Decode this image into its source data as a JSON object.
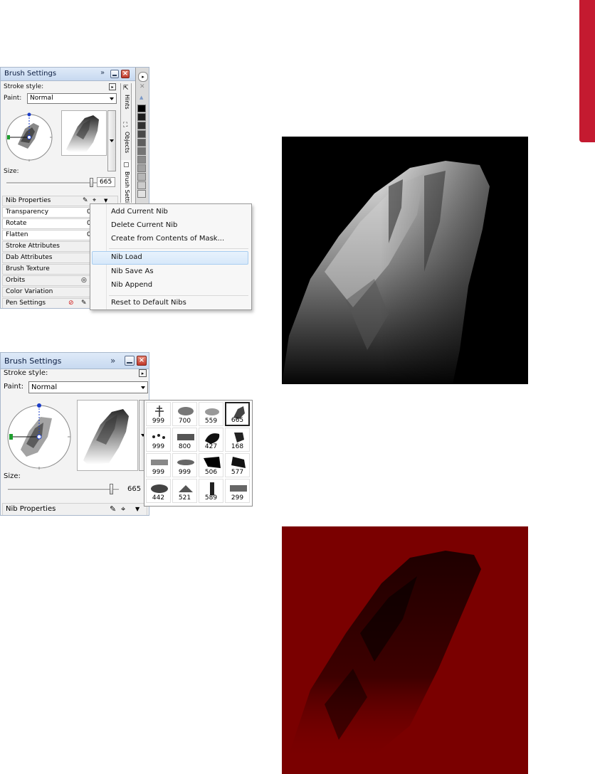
{
  "colors": {
    "accent_tab": "#c41a30",
    "photo_red_bg": "#7a0000",
    "photo_dark_bg": "#000000"
  },
  "panel1": {
    "title": "Brush Settings",
    "stroke_style_label": "Stroke style:",
    "paint_label": "Paint:",
    "paint_value": "Normal",
    "size_label": "Size:",
    "size_value": "665",
    "size_fraction": 0.93,
    "side_tabs": [
      "Hints",
      "Objects",
      "Brush Setti"
    ],
    "sections": {
      "nib_properties": "Nib Properties",
      "transparency": "Transparency",
      "rotate": "Rotate",
      "flatten": "Flatten",
      "stroke_attributes": "Stroke Attributes",
      "dab_attributes": "Dab Attributes",
      "brush_texture": "Brush Texture",
      "orbits": "Orbits",
      "color_variation": "Color Variation",
      "pen_settings": "Pen Settings"
    },
    "values": {
      "transparency": "0",
      "rotate": "0",
      "flatten": "0"
    }
  },
  "context_menu": {
    "items": [
      "Add Current Nib",
      "Delete Current Nib",
      "Create from Contents of Mask...",
      "Nib Load",
      "Nib Save As",
      "Nib Append",
      "Reset to Default Nibs"
    ],
    "highlighted": "Nib Load"
  },
  "panel2": {
    "title": "Brush Settings",
    "stroke_style_label": "Stroke style:",
    "paint_label": "Paint:",
    "paint_value": "Normal",
    "size_label": "Size:",
    "size_value": "665",
    "size_fraction": 0.93,
    "nib_properties": "Nib Properties"
  },
  "nib_grid": {
    "values": [
      "999",
      "700",
      "559",
      "665",
      "999",
      "800",
      "427",
      "168",
      "999",
      "999",
      "506",
      "577",
      "442",
      "521",
      "589",
      "299"
    ],
    "selected": "665"
  },
  "icons": [
    "double-chevron-icon",
    "minimize-icon",
    "close-icon",
    "dropdown-arrow-icon",
    "pen-icon",
    "nib-icon",
    "no-entry-icon",
    "orbit-icon",
    "scroll-up-icon",
    "pin-icon"
  ]
}
